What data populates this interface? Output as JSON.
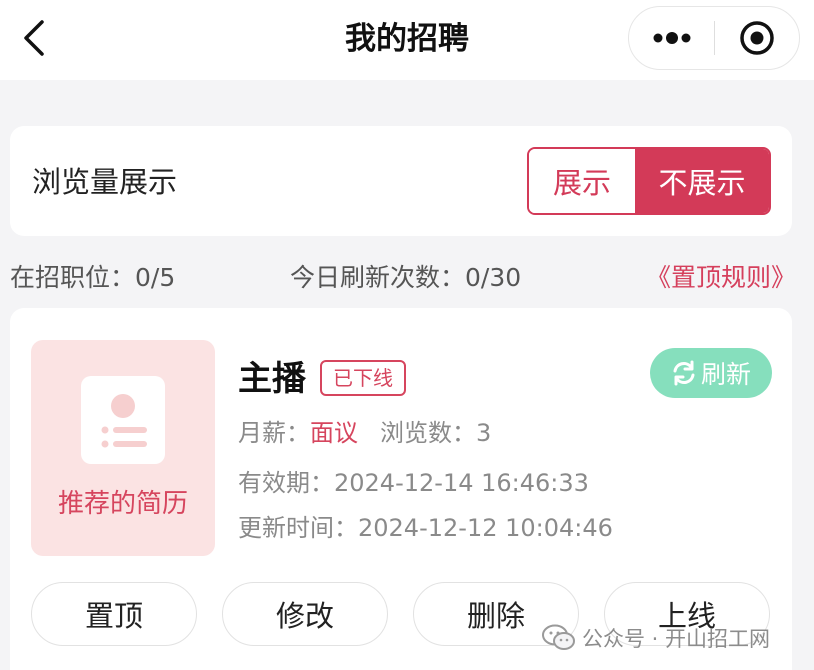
{
  "nav": {
    "title": "我的招聘"
  },
  "views": {
    "label": "浏览量展示",
    "show_label": "展示",
    "hide_label": "不展示",
    "selected": "不展示"
  },
  "stats": {
    "open_positions": "在招职位：0/5",
    "refresh_count": "今日刷新次数：0/30",
    "rules_link": "《置顶规则》"
  },
  "job": {
    "thumbnail_label": "推荐的简历",
    "title": "主播",
    "status": "已下线",
    "refresh_label": "刷新",
    "salary_label": "月薪：",
    "salary_value": "面议",
    "views_label": "浏览数：",
    "views_value": "3",
    "valid_label": "有效期：",
    "valid_value": "2024-12-14 16:46:33",
    "updated_label": "更新时间：",
    "updated_value": "2024-12-12 10:04:46",
    "actions": {
      "pin": "置顶",
      "edit": "修改",
      "delete": "删除",
      "online": "上线"
    }
  },
  "watermark": {
    "text": "公众号 · 开山招工网"
  },
  "colors": {
    "accent": "#d33a58",
    "refresh_green": "#86dfbd",
    "thumb_bg": "#fbe3e3",
    "page_bg": "#f4f4f6"
  },
  "icons": {
    "back": "chevron-left-icon",
    "more": "more-dots-icon",
    "close": "target-circle-icon",
    "refresh": "refresh-cycle-icon",
    "resume": "resume-card-icon",
    "wechat": "wechat-icon"
  }
}
